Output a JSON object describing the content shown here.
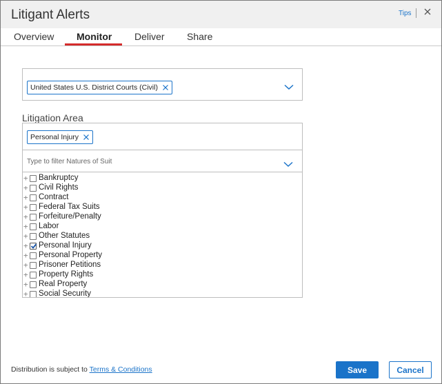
{
  "header": {
    "title": "Litigant Alerts",
    "tips_label": "Tips",
    "close_icon": "close-icon"
  },
  "tabs": [
    {
      "label": "Overview",
      "active": false
    },
    {
      "label": "Monitor",
      "active": true
    },
    {
      "label": "Deliver",
      "active": false
    },
    {
      "label": "Share",
      "active": false
    }
  ],
  "court": {
    "selected_chip": "United States U.S. District Courts (Civil)"
  },
  "litigation_area": {
    "label": "Litigation Area",
    "selected_chip": "Personal Injury",
    "filter_placeholder": "Type to filter Natures of Suit",
    "filter_value": "",
    "items": [
      {
        "label": "Bankruptcy",
        "checked": false
      },
      {
        "label": "Civil Rights",
        "checked": false
      },
      {
        "label": "Contract",
        "checked": false
      },
      {
        "label": "Federal Tax Suits",
        "checked": false
      },
      {
        "label": "Forfeiture/Penalty",
        "checked": false
      },
      {
        "label": "Labor",
        "checked": false
      },
      {
        "label": "Other Statutes",
        "checked": false
      },
      {
        "label": "Personal Injury",
        "checked": true
      },
      {
        "label": "Personal Property",
        "checked": false
      },
      {
        "label": "Prisoner Petitions",
        "checked": false
      },
      {
        "label": "Property Rights",
        "checked": false
      },
      {
        "label": "Real Property",
        "checked": false
      },
      {
        "label": "Social Security",
        "checked": false
      }
    ]
  },
  "footer": {
    "text": "Distribution is subject to ",
    "terms_link": "Terms & Conditions",
    "save_label": "Save",
    "cancel_label": "Cancel"
  },
  "colors": {
    "accent": "#1a73c9",
    "tab_underline": "#d42b2b",
    "header_bg": "#f0f0f0"
  }
}
